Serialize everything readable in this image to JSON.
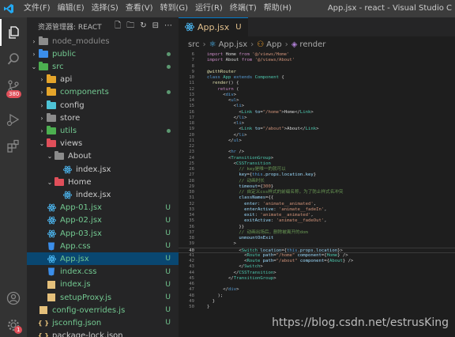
{
  "window": {
    "title": "App.jsx - react - Visual Studio C",
    "menu": [
      "文件(F)",
      "编辑(E)",
      "选择(S)",
      "查看(V)",
      "转到(G)",
      "运行(R)",
      "终端(T)",
      "帮助(H)"
    ]
  },
  "activity": {
    "items": [
      "files-icon",
      "search-icon",
      "source-control-icon",
      "run-debug-icon",
      "extensions-icon",
      "account-icon",
      "settings-icon"
    ],
    "scm_badge": "380",
    "settings_badge": "1"
  },
  "sidebar": {
    "title": "资源管理器: REACT",
    "tree": [
      {
        "label": "node_modules",
        "indent": 1,
        "chev": "›",
        "icon": "folder",
        "color": "#8b8b8b",
        "text_color": "#8b8b8b",
        "status": ""
      },
      {
        "label": "public",
        "indent": 1,
        "chev": "›",
        "icon": "folder",
        "color": "#3b8eea",
        "text_color": "#73c991",
        "status": "dot"
      },
      {
        "label": "src",
        "indent": 1,
        "chev": "⌄",
        "icon": "folder",
        "color": "#4caf50",
        "text_color": "#73c991",
        "status": "dot"
      },
      {
        "label": "api",
        "indent": 2,
        "chev": "›",
        "icon": "folder",
        "color": "#e5a52b",
        "text_color": "#cccccc",
        "status": ""
      },
      {
        "label": "components",
        "indent": 2,
        "chev": "›",
        "icon": "folder",
        "color": "#e5a52b",
        "text_color": "#73c991",
        "status": "dot"
      },
      {
        "label": "config",
        "indent": 2,
        "chev": "›",
        "icon": "folder",
        "color": "#4ec3d6",
        "text_color": "#cccccc",
        "status": ""
      },
      {
        "label": "store",
        "indent": 2,
        "chev": "›",
        "icon": "folder",
        "color": "#8b8b8b",
        "text_color": "#cccccc",
        "status": ""
      },
      {
        "label": "utils",
        "indent": 2,
        "chev": "›",
        "icon": "folder",
        "color": "#4caf50",
        "text_color": "#73c991",
        "status": "dot"
      },
      {
        "label": "views",
        "indent": 2,
        "chev": "⌄",
        "icon": "folder",
        "color": "#e04f5a",
        "text_color": "#cccccc",
        "status": ""
      },
      {
        "label": "About",
        "indent": 3,
        "chev": "⌄",
        "icon": "folder",
        "color": "#8b8b8b",
        "text_color": "#cccccc",
        "status": ""
      },
      {
        "label": "index.jsx",
        "indent": 4,
        "chev": "",
        "icon": "react",
        "color": "#4fc1ff",
        "text_color": "#cccccc",
        "status": ""
      },
      {
        "label": "Home",
        "indent": 3,
        "chev": "⌄",
        "icon": "folder",
        "color": "#e04f5a",
        "text_color": "#cccccc",
        "status": ""
      },
      {
        "label": "index.jsx",
        "indent": 4,
        "chev": "",
        "icon": "react",
        "color": "#4fc1ff",
        "text_color": "#cccccc",
        "status": ""
      },
      {
        "label": "App-01.jsx",
        "indent": 2,
        "chev": "",
        "icon": "react",
        "color": "#4fc1ff",
        "text_color": "#73c991",
        "status": "U"
      },
      {
        "label": "App-02.jsx",
        "indent": 2,
        "chev": "",
        "icon": "react",
        "color": "#4fc1ff",
        "text_color": "#73c991",
        "status": "U"
      },
      {
        "label": "App-03.jsx",
        "indent": 2,
        "chev": "",
        "icon": "react",
        "color": "#4fc1ff",
        "text_color": "#73c991",
        "status": "U"
      },
      {
        "label": "App.css",
        "indent": 2,
        "chev": "",
        "icon": "css",
        "color": "#3b8eea",
        "text_color": "#73c991",
        "status": "U"
      },
      {
        "label": "App.jsx",
        "indent": 2,
        "chev": "",
        "icon": "react",
        "color": "#4fc1ff",
        "text_color": "#73c991",
        "status": "U",
        "selected": true
      },
      {
        "label": "index.css",
        "indent": 2,
        "chev": "",
        "icon": "css",
        "color": "#3b8eea",
        "text_color": "#73c991",
        "status": "U"
      },
      {
        "label": "index.js",
        "indent": 2,
        "chev": "",
        "icon": "js",
        "color": "#e5c07b",
        "text_color": "#73c991",
        "status": "U"
      },
      {
        "label": "setupProxy.js",
        "indent": 2,
        "chev": "",
        "icon": "js",
        "color": "#e5c07b",
        "text_color": "#73c991",
        "status": "U"
      },
      {
        "label": "config-overrides.js",
        "indent": 1,
        "chev": "",
        "icon": "js",
        "color": "#e5c07b",
        "text_color": "#73c991",
        "status": "U"
      },
      {
        "label": "jsconfig.json",
        "indent": 1,
        "chev": "",
        "icon": "json",
        "color": "#e5c07b",
        "text_color": "#73c991",
        "status": "U"
      },
      {
        "label": "package-lock.json",
        "indent": 1,
        "chev": "",
        "icon": "json",
        "color": "#e5c07b",
        "text_color": "#cccccc",
        "status": ""
      }
    ]
  },
  "editor": {
    "tab_label": "App.jsx",
    "tab_status": "U",
    "breadcrumb": [
      "src",
      "App.jsx",
      "App",
      "render"
    ],
    "watermark": "https://blog.csdn.net/estrusKing",
    "lines": [
      {
        "n": "6",
        "segs": [
          [
            "k",
            "import "
          ],
          [
            "p",
            "Home "
          ],
          [
            "k",
            "from "
          ],
          [
            "s",
            "'@/views/Home'"
          ]
        ]
      },
      {
        "n": "7",
        "segs": [
          [
            "k",
            "import "
          ],
          [
            "p",
            "About "
          ],
          [
            "k",
            "from "
          ],
          [
            "s",
            "'@/views/About'"
          ]
        ]
      },
      {
        "n": "8",
        "segs": []
      },
      {
        "n": "9",
        "segs": [
          [
            "f",
            "@withRouter"
          ]
        ]
      },
      {
        "n": "10",
        "segs": [
          [
            "kb",
            "class "
          ],
          [
            "y",
            "App "
          ],
          [
            "kb",
            "extends "
          ],
          [
            "y",
            "Component "
          ],
          [
            "p",
            "{"
          ]
        ]
      },
      {
        "n": "11",
        "segs": [
          [
            "p",
            "  "
          ],
          [
            "f",
            "render"
          ],
          [
            "p",
            "() {"
          ]
        ]
      },
      {
        "n": "12",
        "segs": [
          [
            "p",
            "    "
          ],
          [
            "k",
            "return "
          ],
          [
            "p",
            "("
          ]
        ]
      },
      {
        "n": "13",
        "segs": [
          [
            "p",
            "      <"
          ],
          [
            "t",
            "div"
          ],
          [
            "p",
            ">"
          ]
        ]
      },
      {
        "n": "14",
        "segs": [
          [
            "p",
            "        <"
          ],
          [
            "t",
            "ul"
          ],
          [
            "p",
            ">"
          ]
        ]
      },
      {
        "n": "15",
        "segs": [
          [
            "p",
            "          <"
          ],
          [
            "t",
            "li"
          ],
          [
            "p",
            ">"
          ]
        ]
      },
      {
        "n": "16",
        "segs": [
          [
            "p",
            "            <"
          ],
          [
            "y",
            "Link "
          ],
          [
            "a",
            "to"
          ],
          [
            "p",
            "="
          ],
          [
            "s",
            "\"/home\""
          ],
          [
            "p",
            ">Home</"
          ],
          [
            "y",
            "Link"
          ],
          [
            "p",
            ">"
          ]
        ]
      },
      {
        "n": "17",
        "segs": [
          [
            "p",
            "          </"
          ],
          [
            "t",
            "li"
          ],
          [
            "p",
            ">"
          ]
        ]
      },
      {
        "n": "18",
        "segs": [
          [
            "p",
            "          <"
          ],
          [
            "t",
            "li"
          ],
          [
            "p",
            ">"
          ]
        ]
      },
      {
        "n": "19",
        "segs": [
          [
            "p",
            "            <"
          ],
          [
            "y",
            "Link "
          ],
          [
            "a",
            "to"
          ],
          [
            "p",
            "="
          ],
          [
            "s",
            "\"/about\""
          ],
          [
            "p",
            ">About</"
          ],
          [
            "y",
            "Link"
          ],
          [
            "p",
            ">"
          ]
        ]
      },
      {
        "n": "20",
        "segs": [
          [
            "p",
            "          </"
          ],
          [
            "t",
            "li"
          ],
          [
            "p",
            ">"
          ]
        ]
      },
      {
        "n": "21",
        "segs": [
          [
            "p",
            "        </"
          ],
          [
            "t",
            "ul"
          ],
          [
            "p",
            ">"
          ]
        ]
      },
      {
        "n": "22",
        "segs": []
      },
      {
        "n": "23",
        "segs": [
          [
            "p",
            "        <"
          ],
          [
            "t",
            "hr "
          ],
          [
            "p",
            "/>"
          ]
        ]
      },
      {
        "n": "24",
        "segs": [
          [
            "p",
            "        <"
          ],
          [
            "y",
            "TransitionGroup"
          ],
          [
            "p",
            ">"
          ]
        ]
      },
      {
        "n": "25",
        "segs": [
          [
            "p",
            "          <"
          ],
          [
            "y",
            "CSSTransition"
          ]
        ]
      },
      {
        "n": "26",
        "segs": [
          [
            "c",
            "            // key是唯一的就可以"
          ]
        ]
      },
      {
        "n": "27",
        "segs": [
          [
            "p",
            "            "
          ],
          [
            "a",
            "key"
          ],
          [
            "p",
            "={"
          ],
          [
            "kb",
            "this"
          ],
          [
            "p",
            "."
          ],
          [
            "a",
            "props"
          ],
          [
            "p",
            "."
          ],
          [
            "a",
            "location"
          ],
          [
            "p",
            "."
          ],
          [
            "a",
            "key"
          ],
          [
            "p",
            "}"
          ]
        ]
      },
      {
        "n": "28",
        "segs": [
          [
            "c",
            "            // 动画时长"
          ]
        ]
      },
      {
        "n": "29",
        "segs": [
          [
            "p",
            "            "
          ],
          [
            "a",
            "timeout"
          ],
          [
            "p",
            "={"
          ],
          [
            "s",
            "300"
          ],
          [
            "p",
            "}"
          ]
        ]
      },
      {
        "n": "30",
        "segs": [
          [
            "c",
            "            // 自定义css样式的前缀名称，为了防止样式名冲突"
          ]
        ]
      },
      {
        "n": "31",
        "segs": [
          [
            "p",
            "            "
          ],
          [
            "a",
            "classNames"
          ],
          [
            "p",
            "={{"
          ]
        ]
      },
      {
        "n": "32",
        "segs": [
          [
            "p",
            "              "
          ],
          [
            "a",
            "enter"
          ],
          [
            "p",
            ": "
          ],
          [
            "s",
            "'animate__animated'"
          ],
          [
            "p",
            ","
          ]
        ]
      },
      {
        "n": "33",
        "segs": [
          [
            "p",
            "              "
          ],
          [
            "a",
            "enterActive"
          ],
          [
            "p",
            ": "
          ],
          [
            "s",
            "'animate__fadeIn'"
          ],
          [
            "p",
            ","
          ]
        ]
      },
      {
        "n": "34",
        "segs": [
          [
            "p",
            "              "
          ],
          [
            "a",
            "exit"
          ],
          [
            "p",
            ": "
          ],
          [
            "s",
            "'animate__animated'"
          ],
          [
            "p",
            ","
          ]
        ]
      },
      {
        "n": "35",
        "segs": [
          [
            "p",
            "              "
          ],
          [
            "a",
            "exitActive"
          ],
          [
            "p",
            ": "
          ],
          [
            "s",
            "'animate__fadeOut'"
          ],
          [
            "p",
            ","
          ]
        ]
      },
      {
        "n": "36",
        "segs": [
          [
            "p",
            "            }}"
          ]
        ]
      },
      {
        "n": "37",
        "segs": [
          [
            "c",
            "            // 动画出场后，删除被离开的dom"
          ]
        ]
      },
      {
        "n": "38",
        "segs": [
          [
            "p",
            "            "
          ],
          [
            "a",
            "unmountOnExit"
          ]
        ]
      },
      {
        "n": "39",
        "segs": [
          [
            "p",
            "          >"
          ]
        ]
      },
      {
        "n": "40",
        "cur": true,
        "segs": [
          [
            "p",
            "            <"
          ],
          [
            "y",
            "Switch "
          ],
          [
            "a",
            "location"
          ],
          [
            "p",
            "={"
          ],
          [
            "kb",
            "this"
          ],
          [
            "p",
            "."
          ],
          [
            "a",
            "props"
          ],
          [
            "p",
            "."
          ],
          [
            "a",
            "location"
          ],
          [
            "p",
            "}>"
          ]
        ]
      },
      {
        "n": "41",
        "segs": [
          [
            "p",
            "              <"
          ],
          [
            "y",
            "Route "
          ],
          [
            "a",
            "path"
          ],
          [
            "p",
            "="
          ],
          [
            "s",
            "\"/home\" "
          ],
          [
            "a",
            "component"
          ],
          [
            "p",
            "={"
          ],
          [
            "y",
            "Home"
          ],
          [
            "p",
            "} />"
          ]
        ]
      },
      {
        "n": "42",
        "segs": [
          [
            "p",
            "              <"
          ],
          [
            "y",
            "Route "
          ],
          [
            "a",
            "path"
          ],
          [
            "p",
            "="
          ],
          [
            "s",
            "\"/about\" "
          ],
          [
            "a",
            "component"
          ],
          [
            "p",
            "={"
          ],
          [
            "y",
            "About"
          ],
          [
            "p",
            "} />"
          ]
        ]
      },
      {
        "n": "43",
        "segs": [
          [
            "p",
            "            </"
          ],
          [
            "y",
            "Switch"
          ],
          [
            "p",
            ">"
          ]
        ]
      },
      {
        "n": "44",
        "segs": [
          [
            "p",
            "          </"
          ],
          [
            "y",
            "CSSTransition"
          ],
          [
            "p",
            ">"
          ]
        ]
      },
      {
        "n": "45",
        "segs": [
          [
            "p",
            "        </"
          ],
          [
            "y",
            "TransitionGroup"
          ],
          [
            "p",
            ">"
          ]
        ]
      },
      {
        "n": "46",
        "segs": []
      },
      {
        "n": "47",
        "segs": [
          [
            "p",
            "      </"
          ],
          [
            "t",
            "div"
          ],
          [
            "p",
            ">"
          ]
        ]
      },
      {
        "n": "48",
        "segs": [
          [
            "p",
            "    );"
          ]
        ]
      },
      {
        "n": "49",
        "segs": [
          [
            "p",
            "  }"
          ]
        ]
      },
      {
        "n": "50",
        "segs": [
          [
            "p",
            "}"
          ]
        ]
      }
    ]
  }
}
